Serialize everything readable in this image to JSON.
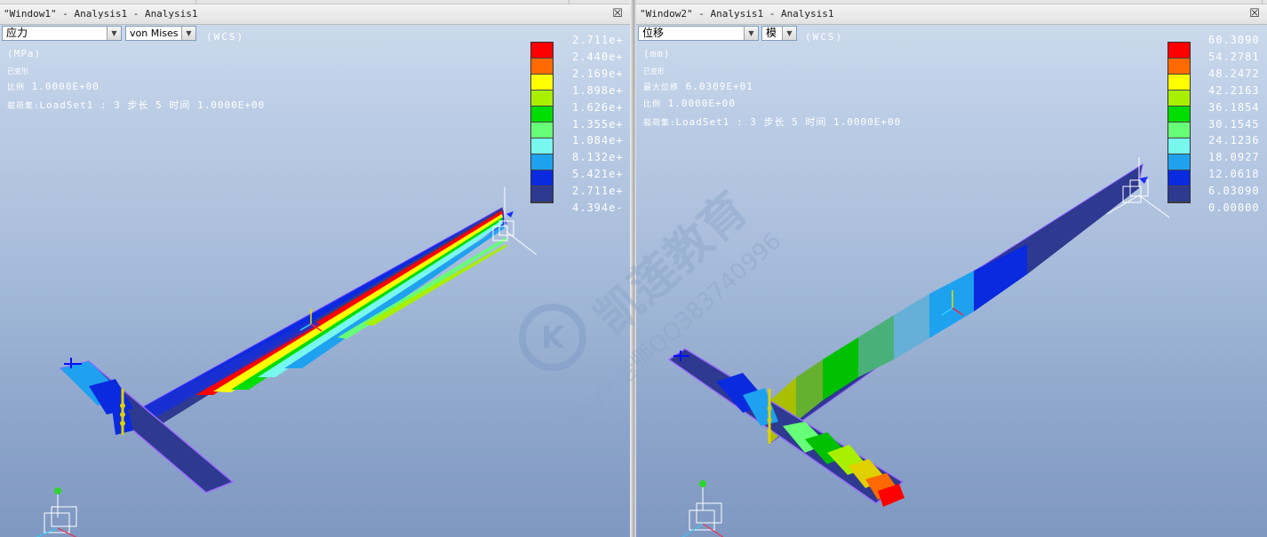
{
  "top_tabs": [
    {
      "label": ""
    },
    {
      "label": ""
    },
    {
      "label": ""
    }
  ],
  "windows": [
    {
      "title": "\"Window1\" - Analysis1 - Analysis1",
      "result_type": "应力",
      "component": "von Mises",
      "csys": "(WCS)",
      "info_lines": [
        {
          "size": "l",
          "text": "(MPa)"
        },
        {
          "size": "s",
          "text": "已变形"
        },
        {
          "size": "l",
          "text": "比例  1.0000E+00",
          "label": "比例",
          "value": "1.0000E+00"
        },
        {
          "size": "l",
          "text": "载荷集:LoadSet1 :  3 步长 5 时间  1.0000E+00",
          "label": "载荷集:",
          "value": "LoadSet1 :  3 步长 5 时间  1.0000E+00"
        }
      ],
      "legend_colors": [
        "#ff0000",
        "#ff6a00",
        "#ffff00",
        "#a8ef00",
        "#00dd00",
        "#66ff77",
        "#77f7ee",
        "#1ea2ef",
        "#0a2ae0",
        "#2e3990"
      ],
      "legend_values": [
        "2.711e+",
        "2.440e+",
        "2.169e+",
        "1.898e+",
        "1.626e+",
        "1.355e+",
        "1.084e+",
        "8.132e+",
        "5.421e+",
        "2.711e+",
        "4.394e-"
      ]
    },
    {
      "title": "\"Window2\" - Analysis1 - Analysis1",
      "result_type": "位移",
      "component": "模",
      "csys": "(WCS)",
      "info_lines": [
        {
          "size": "l",
          "text": "(mm)"
        },
        {
          "size": "s",
          "text": "已变形"
        },
        {
          "size": "l",
          "text": "最大位移  6.0309E+01",
          "label": "最大位移",
          "value": "6.0309E+01"
        },
        {
          "size": "l",
          "text": "比例  1.0000E+00",
          "label": "比例",
          "value": "1.0000E+00"
        },
        {
          "size": "l",
          "text": "载荷集:LoadSet1 :  3 步长 5 时间  1.0000E+00",
          "label": "载荷集:",
          "value": "LoadSet1 :  3 步长 5 时间  1.0000E+00"
        }
      ],
      "legend_colors": [
        "#ff0000",
        "#ff6a00",
        "#ffff00",
        "#a8ef00",
        "#00dd00",
        "#66ff77",
        "#77f7ee",
        "#1ea2ef",
        "#0a2ae0",
        "#2e3990"
      ],
      "legend_values": [
        "60.3090",
        "54.2781",
        "48.2472",
        "42.2163",
        "36.1854",
        "30.1545",
        "24.1236",
        "18.0927",
        "12.0618",
        "6.03090",
        "0.00000"
      ]
    }
  ],
  "watermark": {
    "brand": "凯莲教育",
    "teacher": "kevin老师QQ383740996"
  },
  "icons": [
    "close-icon",
    "dropdown-arrow-icon",
    "coordinate-system-icon",
    "constraint-icon",
    "load-icon"
  ]
}
